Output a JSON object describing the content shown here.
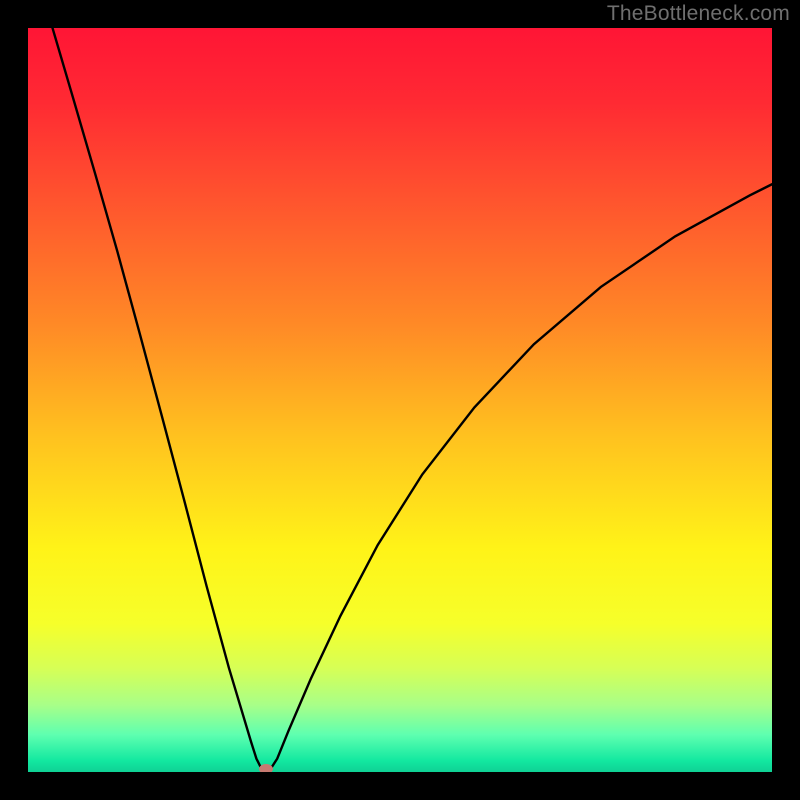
{
  "watermark": {
    "text": "TheBottleneck.com"
  },
  "chart_data": {
    "type": "line",
    "title": "",
    "xlabel": "",
    "ylabel": "",
    "xlim": [
      0,
      1
    ],
    "ylim": [
      0,
      1
    ],
    "grid": false,
    "legend": false,
    "background_gradient": {
      "stops": [
        {
          "offset": 0.0,
          "color": "#ff1535"
        },
        {
          "offset": 0.1,
          "color": "#ff2a33"
        },
        {
          "offset": 0.25,
          "color": "#ff5a2d"
        },
        {
          "offset": 0.4,
          "color": "#ff8a26"
        },
        {
          "offset": 0.55,
          "color": "#ffc21f"
        },
        {
          "offset": 0.7,
          "color": "#fff318"
        },
        {
          "offset": 0.8,
          "color": "#f6ff2a"
        },
        {
          "offset": 0.86,
          "color": "#d7ff55"
        },
        {
          "offset": 0.91,
          "color": "#a8ff88"
        },
        {
          "offset": 0.95,
          "color": "#5effb0"
        },
        {
          "offset": 0.985,
          "color": "#12e8a0"
        },
        {
          "offset": 1.0,
          "color": "#0fd195"
        }
      ]
    },
    "series": [
      {
        "name": "bottleneck-curve",
        "color": "#000000",
        "width": 2.4,
        "x": [
          0.03,
          0.06,
          0.09,
          0.12,
          0.15,
          0.18,
          0.21,
          0.24,
          0.27,
          0.3,
          0.307,
          0.314,
          0.32,
          0.326,
          0.335,
          0.35,
          0.38,
          0.42,
          0.47,
          0.53,
          0.6,
          0.68,
          0.77,
          0.87,
          0.97,
          1.0
        ],
        "y": [
          1.01,
          0.908,
          0.805,
          0.7,
          0.59,
          0.478,
          0.365,
          0.25,
          0.14,
          0.04,
          0.018,
          0.004,
          0.0,
          0.004,
          0.018,
          0.055,
          0.125,
          0.21,
          0.305,
          0.4,
          0.49,
          0.575,
          0.652,
          0.72,
          0.775,
          0.79
        ]
      }
    ],
    "marker": {
      "x": 0.32,
      "y": 0.0,
      "color": "#c77a71"
    }
  }
}
